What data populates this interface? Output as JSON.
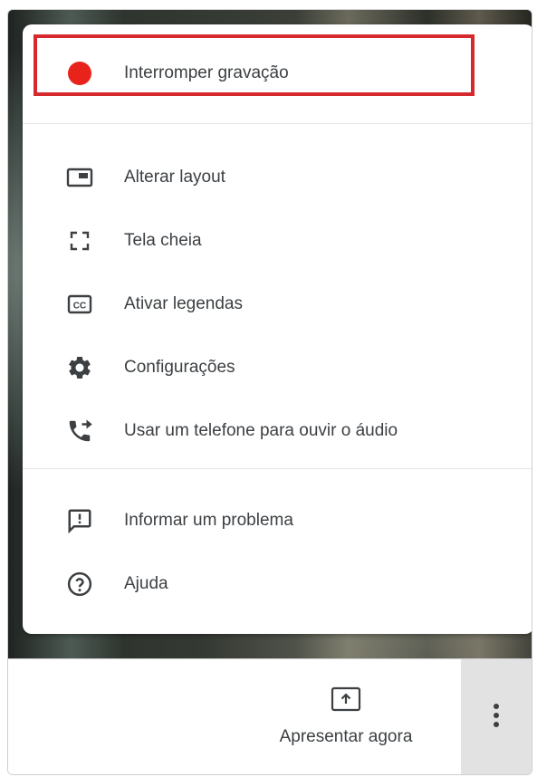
{
  "menu": {
    "items": [
      {
        "label": "Interromper gravação",
        "icon": "record-icon"
      },
      {
        "label": "Alterar layout",
        "icon": "layout-icon"
      },
      {
        "label": "Tela cheia",
        "icon": "fullscreen-icon"
      },
      {
        "label": "Ativar legendas",
        "icon": "captions-icon"
      },
      {
        "label": "Configurações",
        "icon": "gear-icon"
      },
      {
        "label": "Usar um telefone para ouvir o áudio",
        "icon": "phone-forward-icon"
      },
      {
        "label": "Informar um problema",
        "icon": "report-problem-icon"
      },
      {
        "label": "Ajuda",
        "icon": "help-icon"
      }
    ]
  },
  "bottom_bar": {
    "present_label": "Apresentar agora"
  },
  "colors": {
    "record": "#e8231c",
    "highlight": "#d6292d",
    "icon": "#3c4043"
  }
}
